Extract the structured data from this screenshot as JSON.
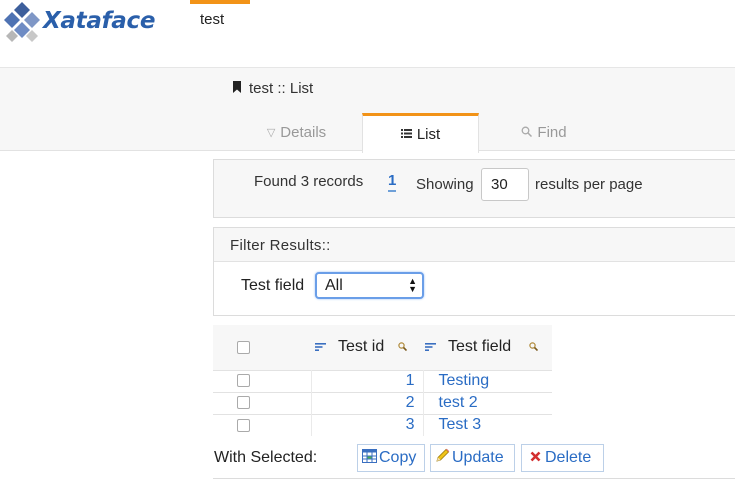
{
  "app": {
    "logo_text": "Xataface",
    "table_tab": "test"
  },
  "breadcrumb": "test :: List",
  "view_tabs": [
    {
      "label": "Details",
      "icon": "filter-icon",
      "active": false
    },
    {
      "label": "List",
      "icon": "list-icon",
      "active": true
    },
    {
      "label": "Find",
      "icon": "search-icon",
      "active": false
    }
  ],
  "results": {
    "found_text": "Found 3 records",
    "page": "1",
    "showing_label": "Showing",
    "per_page_value": "30",
    "per_page_label": "results per page"
  },
  "filter": {
    "title": "Filter Results::",
    "field_label": "Test field",
    "selected": "All"
  },
  "table": {
    "columns": [
      "Test id",
      "Test field"
    ],
    "rows": [
      {
        "id": "1",
        "field": "Testing"
      },
      {
        "id": "2",
        "field": "test 2"
      },
      {
        "id": "3",
        "field": "Test 3"
      }
    ]
  },
  "actions": {
    "with_selected": "With Selected:",
    "copy": "Copy",
    "update": "Update",
    "delete": "Delete"
  },
  "colors": {
    "accent": "#f29318",
    "link": "#2a6cc4",
    "logo": "#2a5faa"
  }
}
